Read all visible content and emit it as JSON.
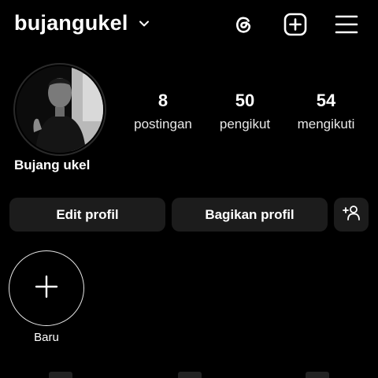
{
  "header": {
    "username": "bujangukel",
    "icons": [
      "chevron-down-icon",
      "threads-icon",
      "add-post-icon",
      "menu-icon"
    ]
  },
  "profile": {
    "display_name": "Bujang ukel",
    "stats": [
      {
        "value": "8",
        "label": "postingan"
      },
      {
        "value": "50",
        "label": "pengikut"
      },
      {
        "value": "54",
        "label": "mengikuti"
      }
    ]
  },
  "actions": {
    "edit_label": "Edit profil",
    "share_label": "Bagikan profil",
    "discover_icon": "add-person-icon"
  },
  "highlights": {
    "new_label": "Baru",
    "new_icon": "plus-icon"
  },
  "colors": {
    "background": "#000000",
    "button_bg": "#1c1c1c",
    "text": "#ffffff"
  }
}
